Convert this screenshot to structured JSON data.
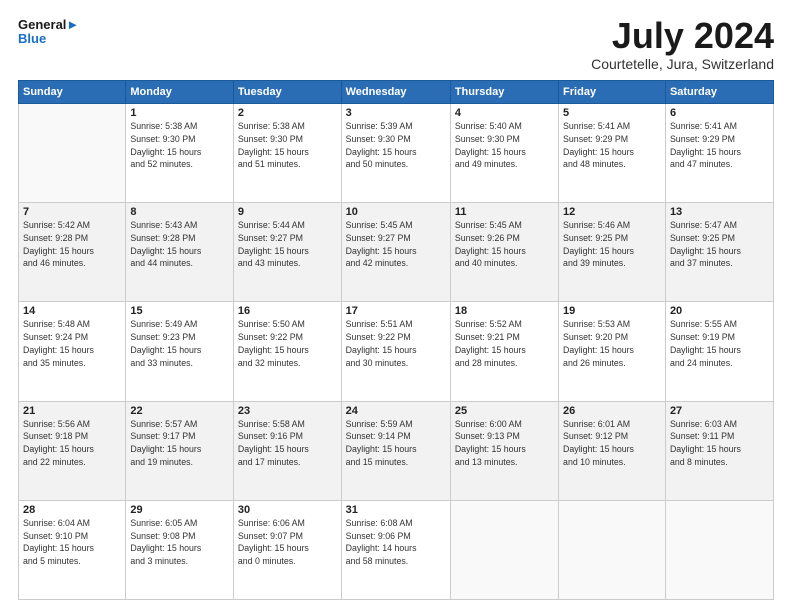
{
  "logo": {
    "line1": "General",
    "line2": "Blue"
  },
  "title": "July 2024",
  "subtitle": "Courtetelle, Jura, Switzerland",
  "days_header": [
    "Sunday",
    "Monday",
    "Tuesday",
    "Wednesday",
    "Thursday",
    "Friday",
    "Saturday"
  ],
  "weeks": [
    [
      {
        "num": "",
        "info": ""
      },
      {
        "num": "1",
        "info": "Sunrise: 5:38 AM\nSunset: 9:30 PM\nDaylight: 15 hours\nand 52 minutes."
      },
      {
        "num": "2",
        "info": "Sunrise: 5:38 AM\nSunset: 9:30 PM\nDaylight: 15 hours\nand 51 minutes."
      },
      {
        "num": "3",
        "info": "Sunrise: 5:39 AM\nSunset: 9:30 PM\nDaylight: 15 hours\nand 50 minutes."
      },
      {
        "num": "4",
        "info": "Sunrise: 5:40 AM\nSunset: 9:30 PM\nDaylight: 15 hours\nand 49 minutes."
      },
      {
        "num": "5",
        "info": "Sunrise: 5:41 AM\nSunset: 9:29 PM\nDaylight: 15 hours\nand 48 minutes."
      },
      {
        "num": "6",
        "info": "Sunrise: 5:41 AM\nSunset: 9:29 PM\nDaylight: 15 hours\nand 47 minutes."
      }
    ],
    [
      {
        "num": "7",
        "info": "Sunrise: 5:42 AM\nSunset: 9:28 PM\nDaylight: 15 hours\nand 46 minutes."
      },
      {
        "num": "8",
        "info": "Sunrise: 5:43 AM\nSunset: 9:28 PM\nDaylight: 15 hours\nand 44 minutes."
      },
      {
        "num": "9",
        "info": "Sunrise: 5:44 AM\nSunset: 9:27 PM\nDaylight: 15 hours\nand 43 minutes."
      },
      {
        "num": "10",
        "info": "Sunrise: 5:45 AM\nSunset: 9:27 PM\nDaylight: 15 hours\nand 42 minutes."
      },
      {
        "num": "11",
        "info": "Sunrise: 5:45 AM\nSunset: 9:26 PM\nDaylight: 15 hours\nand 40 minutes."
      },
      {
        "num": "12",
        "info": "Sunrise: 5:46 AM\nSunset: 9:25 PM\nDaylight: 15 hours\nand 39 minutes."
      },
      {
        "num": "13",
        "info": "Sunrise: 5:47 AM\nSunset: 9:25 PM\nDaylight: 15 hours\nand 37 minutes."
      }
    ],
    [
      {
        "num": "14",
        "info": "Sunrise: 5:48 AM\nSunset: 9:24 PM\nDaylight: 15 hours\nand 35 minutes."
      },
      {
        "num": "15",
        "info": "Sunrise: 5:49 AM\nSunset: 9:23 PM\nDaylight: 15 hours\nand 33 minutes."
      },
      {
        "num": "16",
        "info": "Sunrise: 5:50 AM\nSunset: 9:22 PM\nDaylight: 15 hours\nand 32 minutes."
      },
      {
        "num": "17",
        "info": "Sunrise: 5:51 AM\nSunset: 9:22 PM\nDaylight: 15 hours\nand 30 minutes."
      },
      {
        "num": "18",
        "info": "Sunrise: 5:52 AM\nSunset: 9:21 PM\nDaylight: 15 hours\nand 28 minutes."
      },
      {
        "num": "19",
        "info": "Sunrise: 5:53 AM\nSunset: 9:20 PM\nDaylight: 15 hours\nand 26 minutes."
      },
      {
        "num": "20",
        "info": "Sunrise: 5:55 AM\nSunset: 9:19 PM\nDaylight: 15 hours\nand 24 minutes."
      }
    ],
    [
      {
        "num": "21",
        "info": "Sunrise: 5:56 AM\nSunset: 9:18 PM\nDaylight: 15 hours\nand 22 minutes."
      },
      {
        "num": "22",
        "info": "Sunrise: 5:57 AM\nSunset: 9:17 PM\nDaylight: 15 hours\nand 19 minutes."
      },
      {
        "num": "23",
        "info": "Sunrise: 5:58 AM\nSunset: 9:16 PM\nDaylight: 15 hours\nand 17 minutes."
      },
      {
        "num": "24",
        "info": "Sunrise: 5:59 AM\nSunset: 9:14 PM\nDaylight: 15 hours\nand 15 minutes."
      },
      {
        "num": "25",
        "info": "Sunrise: 6:00 AM\nSunset: 9:13 PM\nDaylight: 15 hours\nand 13 minutes."
      },
      {
        "num": "26",
        "info": "Sunrise: 6:01 AM\nSunset: 9:12 PM\nDaylight: 15 hours\nand 10 minutes."
      },
      {
        "num": "27",
        "info": "Sunrise: 6:03 AM\nSunset: 9:11 PM\nDaylight: 15 hours\nand 8 minutes."
      }
    ],
    [
      {
        "num": "28",
        "info": "Sunrise: 6:04 AM\nSunset: 9:10 PM\nDaylight: 15 hours\nand 5 minutes."
      },
      {
        "num": "29",
        "info": "Sunrise: 6:05 AM\nSunset: 9:08 PM\nDaylight: 15 hours\nand 3 minutes."
      },
      {
        "num": "30",
        "info": "Sunrise: 6:06 AM\nSunset: 9:07 PM\nDaylight: 15 hours\nand 0 minutes."
      },
      {
        "num": "31",
        "info": "Sunrise: 6:08 AM\nSunset: 9:06 PM\nDaylight: 14 hours\nand 58 minutes."
      },
      {
        "num": "",
        "info": ""
      },
      {
        "num": "",
        "info": ""
      },
      {
        "num": "",
        "info": ""
      }
    ]
  ]
}
